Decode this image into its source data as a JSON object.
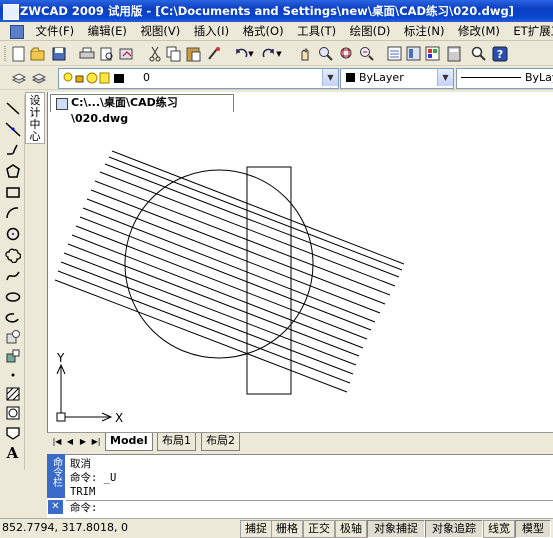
{
  "window": {
    "title": "ZWCAD 2009 试用版 - [C:\\Documents and Settings\\new\\桌面\\CAD练习\\020.dwg]"
  },
  "menu": [
    "文件(F)",
    "编辑(E)",
    "视图(V)",
    "插入(I)",
    "格式(O)",
    "工具(T)",
    "绘图(D)",
    "标注(N)",
    "修改(M)",
    "ET扩展工具(X)"
  ],
  "layer_bar": {
    "layer_value": "0",
    "color_value": "ByLayer",
    "linetype_value": "ByLay"
  },
  "design_center": {
    "label": "设计中心"
  },
  "document": {
    "tab_label": "C:\\...\\桌面\\CAD练习\\020.dwg"
  },
  "ucs": {
    "x_label": "X",
    "y_label": "Y"
  },
  "layout_tabs": [
    "Model",
    "布局1",
    "布局2"
  ],
  "command": {
    "panel_label": "命令栏",
    "history": [
      "取消",
      "命令: _U",
      "TRIM"
    ],
    "prompt": "命令:"
  },
  "status": {
    "coordinates": "852.7794,  317.8018,  0",
    "toggles": [
      {
        "label": "捕捉",
        "active": false
      },
      {
        "label": "栅格",
        "active": false
      },
      {
        "label": "正交",
        "active": false
      },
      {
        "label": "极轴",
        "active": false
      },
      {
        "label": "对象捕捉",
        "active": true
      },
      {
        "label": "对象追踪",
        "active": true
      },
      {
        "label": "线宽",
        "active": false
      },
      {
        "label": "模型",
        "active": true
      }
    ]
  },
  "colors": {
    "title_bar": "#0a3fc2",
    "panel_blue": "#3a6bc8",
    "chrome": "#ece9d8",
    "drawing_bg": "#ffffff"
  }
}
